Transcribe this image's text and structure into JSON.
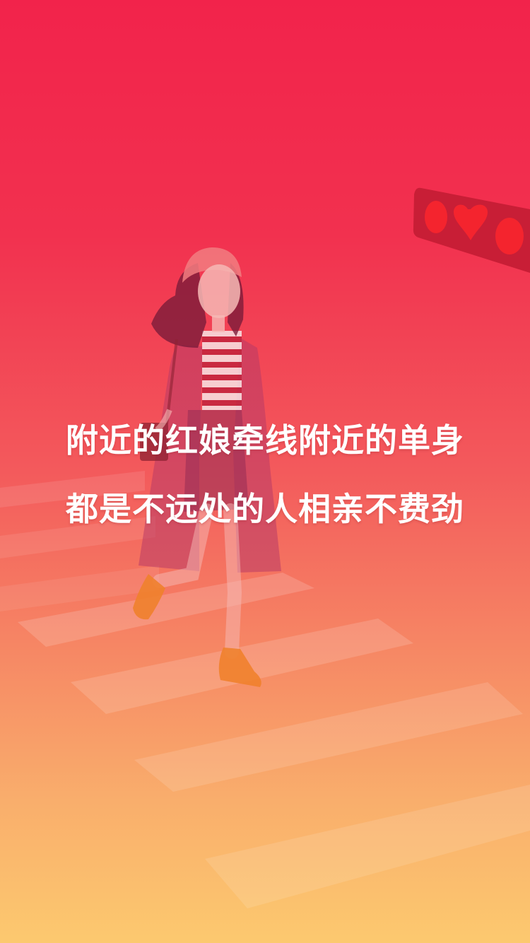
{
  "splash": {
    "slogan_line1": "附近的红娘牵线附近的单身",
    "slogan_line2": "都是不远处的人相亲不费劲"
  },
  "colors": {
    "gradient_top": "#f2234b",
    "gradient_bottom": "#fcc96f",
    "text": "#ffffff"
  },
  "icons": {
    "traffic_light": "heart-traffic-light-icon"
  }
}
